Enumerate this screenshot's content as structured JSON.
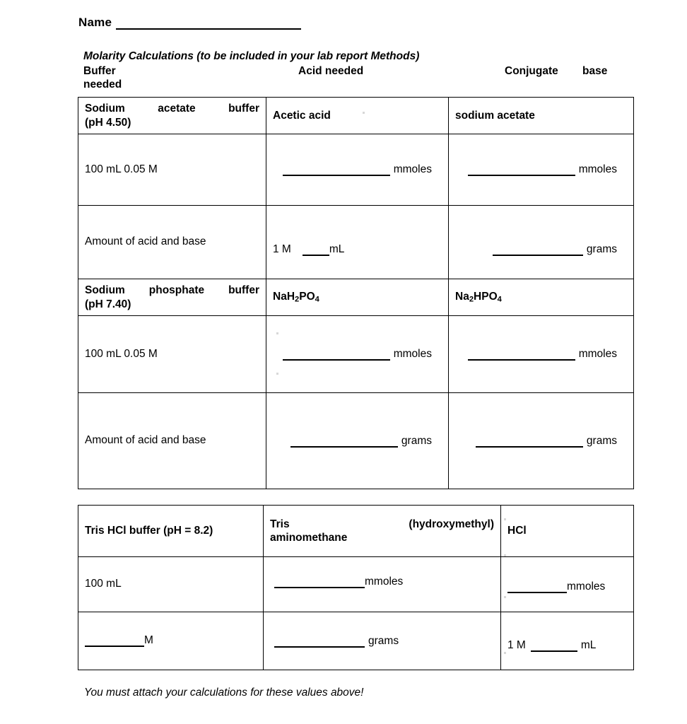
{
  "document": {
    "name_label": "Name",
    "title": "Molarity Calculations (to be included in your lab report Methods)",
    "footnote": "You must attach your calculations for these values above!"
  },
  "column_headers": {
    "buffer": "Buffer",
    "acid_needed": "Acid needed",
    "conjugate": "Conjugate",
    "base": "base",
    "needed": "needed"
  },
  "molarity_table": {
    "rows": [
      {
        "buffer": "Sodium acetate buffer (pH 4.50)",
        "buffer_line1_words": "Sodium acetate buffer",
        "buffer_line2": "(pH 4.50)",
        "acid": "Acetic acid",
        "conjugate": "sodium acetate"
      },
      {
        "buffer": "100 mL 0.05 M",
        "acid_unit": "mmoles",
        "conjugate_unit": "mmoles"
      },
      {
        "buffer": "Amount of acid and base",
        "acid_prefix": "1 M",
        "acid_unit": "mL",
        "conjugate_unit": "grams"
      },
      {
        "buffer_line1_words": "Sodium phosphate buffer",
        "buffer_line2": "(pH 7.40)",
        "acid_formula": "NaH2PO4",
        "conjugate_formula": "Na2HPO4"
      },
      {
        "buffer": "100 mL 0.05 M",
        "acid_unit": "mmoles",
        "conjugate_unit": "mmoles"
      },
      {
        "buffer": "Amount of acid and base",
        "acid_unit": "grams",
        "conjugate_unit": "grams"
      }
    ]
  },
  "tris_table": {
    "rows": [
      {
        "buffer": "Tris HCl buffer (pH = 8.2)",
        "acid_word1": "Tris",
        "acid_word2": "(hydroxymethyl)",
        "acid_line2": "aminomethane",
        "conjugate": "HCl"
      },
      {
        "buffer": "100 mL",
        "acid_unit": "mmoles",
        "conjugate_unit": "mmoles"
      },
      {
        "buffer_unit": "M",
        "acid_unit": "grams",
        "conjugate_prefix": "1 M",
        "conjugate_unit": "mL"
      }
    ]
  }
}
